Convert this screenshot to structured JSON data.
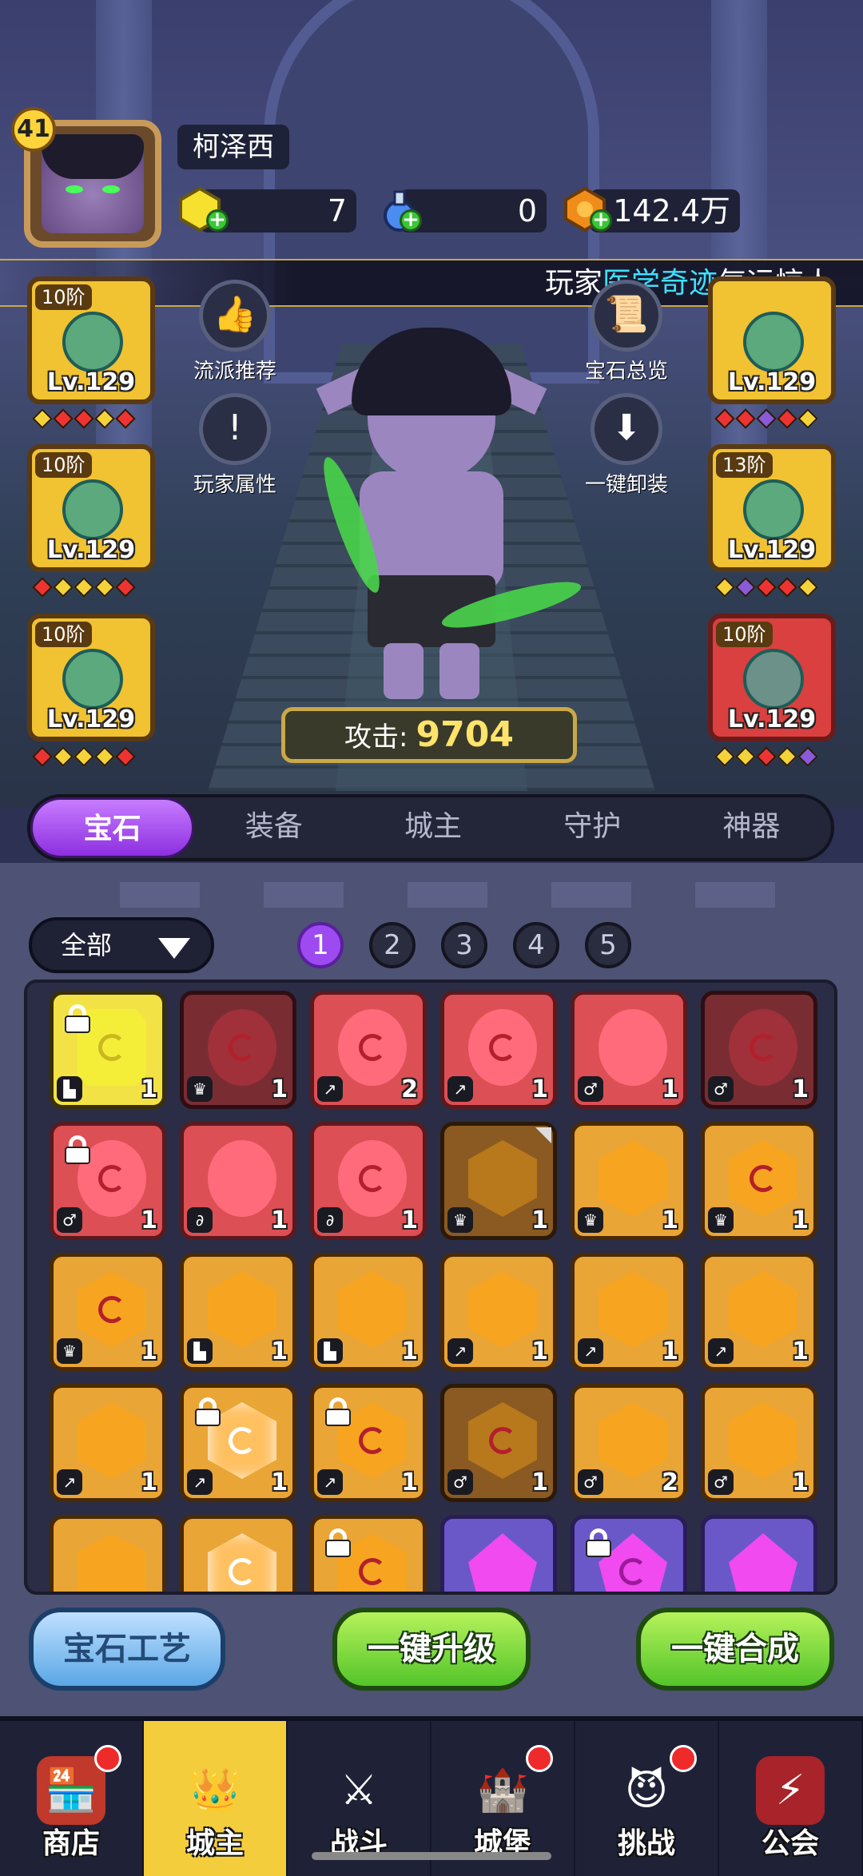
{
  "player": {
    "level": "41",
    "name": "柯泽西"
  },
  "resources": {
    "gems": "7",
    "potions": "0",
    "gold": "142.4万"
  },
  "banner": {
    "prefix": "玩家",
    "highlight": "医学奇迹",
    "suffix": "气运惊人"
  },
  "side_buttons": {
    "recommend": "流派推荐",
    "gem_overview": "宝石总览",
    "attributes": "玩家属性",
    "unequip_all": "一键卸装"
  },
  "equipment": [
    {
      "tier": "10阶",
      "level": "Lv.129",
      "color": "yellow",
      "icon": "wizard-hat-icon"
    },
    {
      "tier": "10阶",
      "level": "Lv.129",
      "color": "yellow",
      "icon": "robe-icon"
    },
    {
      "tier": "10阶",
      "level": "Lv.129",
      "color": "yellow",
      "icon": "boot-icon"
    },
    {
      "tier": "",
      "level": "Lv.129",
      "color": "yellow",
      "icon": "staff-icon"
    },
    {
      "tier": "13阶",
      "level": "Lv.129",
      "color": "yellow",
      "icon": "ring-icon"
    },
    {
      "tier": "10阶",
      "level": "Lv.129",
      "color": "red",
      "icon": "necklace-icon"
    }
  ],
  "attack": {
    "label": "攻击:",
    "value": "9704"
  },
  "tabs": [
    "宝石",
    "装备",
    "城主",
    "守护",
    "神器"
  ],
  "active_tab": "宝石",
  "filter": {
    "label": "全部"
  },
  "pages": [
    "1",
    "2",
    "3",
    "4",
    "5"
  ],
  "active_page": "1",
  "buttons": {
    "craft": "宝石工艺",
    "upgrade": "一键升级",
    "combine": "一键合成"
  },
  "nav": [
    {
      "label": "商店",
      "icon": "shop-icon",
      "badge": true
    },
    {
      "label": "城主",
      "icon": "crown-icon",
      "badge": false
    },
    {
      "label": "战斗",
      "icon": "crossed-swords-icon",
      "badge": false
    },
    {
      "label": "城堡",
      "icon": "castle-icon",
      "badge": true
    },
    {
      "label": "挑战",
      "icon": "demon-icon",
      "badge": true
    },
    {
      "label": "公会",
      "icon": "guild-banner-icon",
      "badge": false
    }
  ],
  "colors": {
    "accent_purple": "#9d4bf0",
    "gold": "#f1c232",
    "green_button": "#53c52a",
    "highlight_text": "#3ee0ff"
  }
}
